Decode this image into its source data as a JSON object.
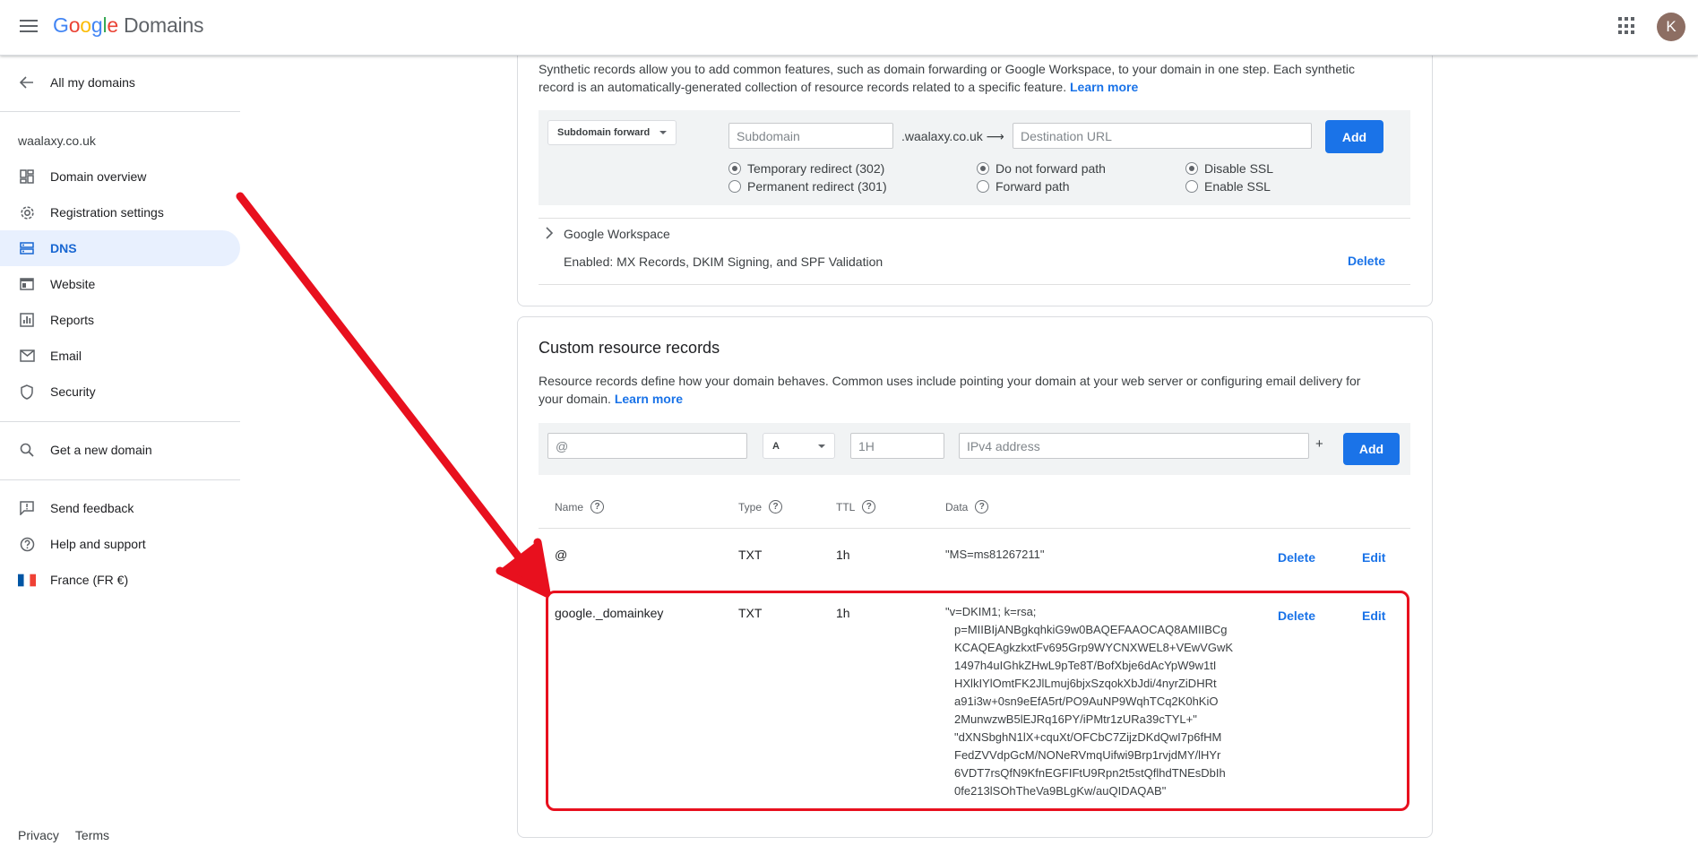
{
  "header": {
    "logo_letters": [
      "G",
      "o",
      "o",
      "g",
      "l",
      "e"
    ],
    "logo_product": "Domains",
    "avatar_letter": "K",
    "menu_icon": "hamburger-icon",
    "apps_icon": "apps-grid-icon"
  },
  "sidebar": {
    "back_label": "All my domains",
    "domain": "waalaxy.co.uk",
    "items": [
      {
        "label": "Domain overview",
        "icon": "dashboard-icon"
      },
      {
        "label": "Registration settings",
        "icon": "gear-icon"
      },
      {
        "label": "DNS",
        "icon": "dns-icon"
      },
      {
        "label": "Website",
        "icon": "website-icon"
      },
      {
        "label": "Reports",
        "icon": "reports-icon"
      },
      {
        "label": "Email",
        "icon": "email-icon"
      },
      {
        "label": "Security",
        "icon": "shield-icon"
      }
    ],
    "active_item": "DNS",
    "get_domain": "Get a new domain",
    "feedback": "Send feedback",
    "help": "Help and support",
    "region": "France (FR €)",
    "privacy": "Privacy",
    "terms": "Terms"
  },
  "synthetic": {
    "desc_line1": "Synthetic records allow you to add common features, such as domain forwarding or Google Workspace, to your domain in one step. Each synthetic",
    "desc_line2": "record is an automatically-generated collection of resource records related to a specific feature.",
    "learn_more": "Learn more",
    "type_select": "Subdomain forward",
    "subdomain_placeholder": "Subdomain",
    "suffix": ".waalaxy.co.uk ⟶",
    "destination_placeholder": "Destination URL",
    "add_label": "Add",
    "radios": {
      "temp": "Temporary redirect (302)",
      "perm": "Permanent redirect (301)",
      "no_path": "Do not forward path",
      "path": "Forward path",
      "disable_ssl": "Disable SSL",
      "enable_ssl": "Enable SSL"
    },
    "workspace_title": "Google Workspace",
    "workspace_desc": "Enabled: MX Records, DKIM Signing, and SPF Validation",
    "workspace_delete": "Delete"
  },
  "custom": {
    "title": "Custom resource records",
    "desc_line1": "Resource records define how your domain behaves. Common uses include pointing your domain at your web server or configuring email delivery for",
    "desc_line2": "your domain.",
    "learn_more": "Learn more",
    "name_placeholder": "@",
    "type_value": "A",
    "ttl_placeholder": "1H",
    "data_placeholder": "IPv4 address",
    "plus": "+",
    "add_label": "Add",
    "columns": {
      "name": "Name",
      "type": "Type",
      "ttl": "TTL",
      "data": "Data"
    },
    "rows": [
      {
        "name": "@",
        "type": "TXT",
        "ttl": "1h",
        "data": "\"MS=ms81267211\"",
        "delete": "Delete",
        "edit": "Edit"
      },
      {
        "name": "google._domainkey",
        "type": "TXT",
        "ttl": "1h",
        "delete": "Delete",
        "edit": "Edit",
        "data_lines": [
          "\"v=DKIM1; k=rsa;",
          "p=MIIBIjANBgkqhkiG9w0BAQEFAAOCAQ8AMIIBCg",
          "KCAQEAgkzkxtFv695Grp9WYCNXWEL8+VEwVGwK",
          "1497h4uIGhkZHwL9pTe8T/BofXbje6dAcYpW9w1tI",
          "HXlkIYlOmtFK2JlLmuj6bjxSzqokXbJdi/4nyrZiDHRt",
          "a91i3w+0sn9eEfA5rt/PO9AuNP9WqhTCq2K0hKiO",
          "2MunwzwB5lEJRq16PY/iPMtr1zURa39cTYL+\"",
          "\"dXNSbghN1lX+cquXt/OFCbC7ZijzDKdQwI7p6fHM",
          "FedZVVdpGcM/NONeRVmqUifwi9Brp1rvjdMY/lHYr",
          "6VDT7rsQfN9KfnEGFIFtU9Rpn2t5stQflhdTNEsDbIh",
          "0fe213lSOhTheVa9BLgKw/auQIDAQAB\""
        ]
      }
    ]
  },
  "colors": {
    "accent": "#1a73e8",
    "highlight_red": "#e8101e",
    "active_bg": "#e8f0fe"
  }
}
